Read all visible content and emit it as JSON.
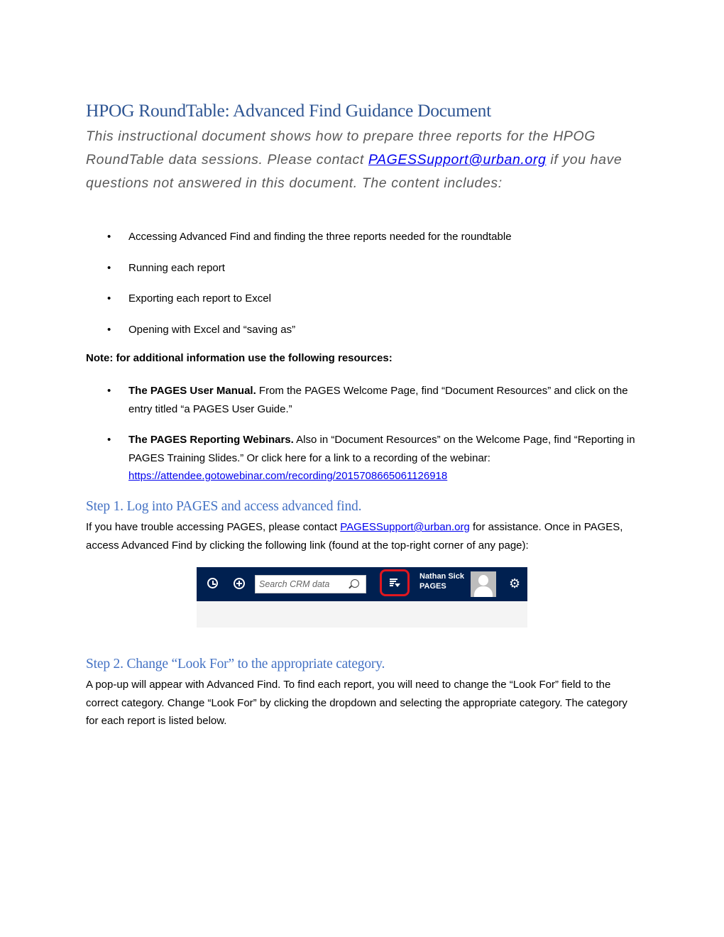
{
  "document": {
    "title": "HPOG RoundTable: Advanced Find Guidance Document",
    "subtitle": {
      "before": "This instructional document shows how to prepare three reports for the HPOG RoundTable data sessions. Please contact ",
      "email": "PAGESSupport@urban.org",
      "after": " if you have questions not answered in this document. The content includes:"
    },
    "content_items": [
      "Accessing Advanced Find and finding the three reports needed for the roundtable",
      "Running each report",
      "Exporting each report to Excel",
      "Opening with Excel and “saving as”"
    ],
    "note": "Note: for additional information use the following resources:",
    "resources": [
      {
        "bold": "The PAGES User Manual.",
        "text": " From the PAGES Welcome Page, find “Document Resources” and click on the entry titled “a PAGES User Guide.”"
      },
      {
        "bold": "The PAGES Reporting Webinars.",
        "text": " Also in “Document Resources” on the Welcome Page, find “Reporting in PAGES Training Slides.” Or click here for a link to a recording of the webinar: ",
        "link": "https://attendee.gotowebinar.com/recording/2015708665061126918"
      }
    ],
    "step1": {
      "heading": "Step 1. Log into PAGES and access advanced find.",
      "before": "If you have trouble accessing PAGES, please contact ",
      "email": "PAGESSupport@urban.org",
      "after": " for assistance. Once in PAGES, access Advanced Find by clicking the following link (found at the top-right corner of any page):"
    },
    "step2": {
      "heading": "Step 2. Change “Look For” to the appropriate category.",
      "text": "A pop-up will appear with Advanced Find. To find each report, you will need to change the “Look For” field to the correct category. Change “Look For” by clicking the dropdown and selecting the appropriate category. The category for each report is listed below."
    }
  },
  "screenshot": {
    "search_placeholder": "Search CRM data",
    "user_name": "Nathan Sick",
    "org": "PAGES",
    "icons": [
      "recent-clock-icon",
      "create-plus-icon",
      "search-icon",
      "advanced-find-icon",
      "avatar",
      "gear-icon"
    ],
    "colors": {
      "nav_bg": "#002050",
      "highlight": "#e0171f"
    }
  },
  "colors": {
    "title": "#2e5593",
    "heading": "#4472c4",
    "link": "#0000ee",
    "subtitle": "#595959"
  }
}
